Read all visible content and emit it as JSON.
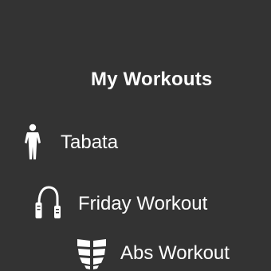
{
  "screen": {
    "background": "#333333",
    "title": "My Workouts"
  },
  "workouts": [
    {
      "label": "Tabata",
      "icon": "standing-person-icon"
    },
    {
      "label": "Friday Workout",
      "icon": "jump-rope-icon"
    },
    {
      "label": "Abs Workout",
      "icon": "abs-icon"
    }
  ]
}
